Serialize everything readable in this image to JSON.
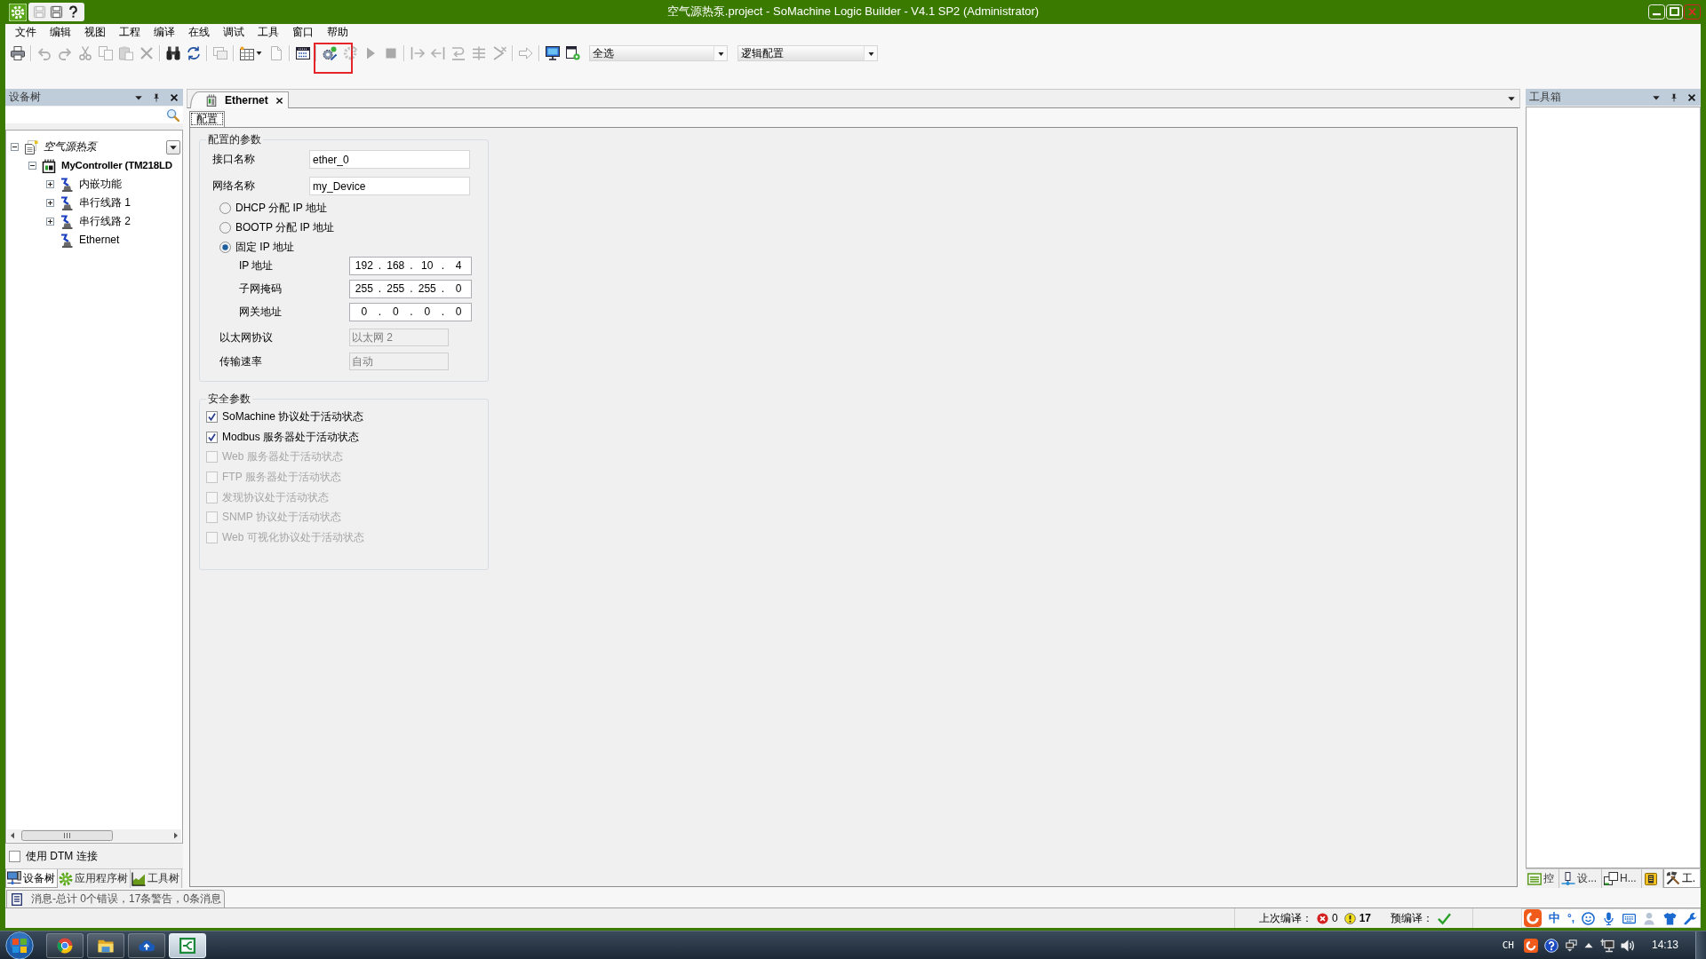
{
  "window": {
    "title": "空气源热泵.project - SoMachine Logic Builder - V4.1 SP2 (Administrator)"
  },
  "quick_access": [
    {
      "disabled": true
    },
    {
      "disabled": false
    },
    {
      "disabled": false
    }
  ],
  "menu": [
    "文件",
    "编辑",
    "视图",
    "工程",
    "编译",
    "在线",
    "调试",
    "工具",
    "窗口",
    "帮助"
  ],
  "toolbar": {
    "buttons": [
      {
        "disabled": false,
        "highlighted": false
      },
      {
        "disabled": true,
        "highlighted": false
      },
      {
        "disabled": true,
        "highlighted": false
      },
      {
        "disabled": true,
        "highlighted": false
      },
      {
        "disabled": true,
        "highlighted": false
      },
      {
        "disabled": true,
        "highlighted": false
      },
      {
        "disabled": true,
        "highlighted": false
      },
      {
        "disabled": false,
        "highlighted": false
      },
      {
        "disabled": false,
        "highlighted": false
      },
      {
        "disabled": true,
        "highlighted": false
      },
      {
        "disabled": false,
        "highlighted": false
      },
      {
        "disabled": true,
        "highlighted": false
      },
      {
        "disabled": false,
        "highlighted": false
      },
      {
        "disabled": false,
        "highlighted": true
      },
      {
        "disabled": true,
        "highlighted": false
      },
      {
        "disabled": true,
        "highlighted": false
      },
      {
        "disabled": true,
        "highlighted": false
      },
      {
        "disabled": true,
        "highlighted": false
      },
      {
        "disabled": true,
        "highlighted": false
      },
      {
        "disabled": true,
        "highlighted": false
      },
      {
        "disabled": true,
        "highlighted": false
      },
      {
        "disabled": true,
        "highlighted": false
      },
      {
        "disabled": true,
        "highlighted": false
      },
      {
        "disabled": false,
        "highlighted": false
      },
      {
        "disabled": false,
        "highlighted": false
      }
    ],
    "selects": [
      {
        "value": "全选"
      },
      {
        "value": "逻辑配置"
      }
    ]
  },
  "device_tree": {
    "title": "设备树",
    "items": [
      {
        "kind": "project",
        "label": "空气源热泵",
        "expanded": true,
        "children": [
          {
            "kind": "controller",
            "label": "MyController (TM218LD",
            "expanded": true,
            "children": [
              {
                "kind": "connector",
                "label": "内嵌功能",
                "expanded": false
              },
              {
                "kind": "connector",
                "label": "串行线路 1",
                "expanded": false
              },
              {
                "kind": "connector",
                "label": "串行线路 2",
                "expanded": false
              },
              {
                "kind": "connector",
                "label": "Ethernet"
              }
            ]
          }
        ]
      }
    ],
    "dtm": {
      "label": "使用 DTM 连接",
      "checked": false
    },
    "tabs": [
      {
        "label": "设备树",
        "selected": true
      },
      {
        "label": "应用程序树",
        "selected": false
      },
      {
        "label": "工具树",
        "selected": false
      }
    ]
  },
  "editor": {
    "tabs": [
      {
        "label": "Ethernet",
        "selected": true
      }
    ],
    "subtabs": [
      {
        "label": "配置",
        "selected": true
      }
    ],
    "config": {
      "title": "配置的参数",
      "fields": [
        {
          "label": "接口名称",
          "value": "ether_0"
        },
        {
          "label": "网络名称",
          "value": "my_Device"
        }
      ],
      "ip_modes": [
        {
          "label": "DHCP 分配 IP 地址",
          "selected": false
        },
        {
          "label": "BOOTP 分配 IP 地址",
          "selected": false
        },
        {
          "label": "固定 IP 地址",
          "selected": true
        }
      ],
      "octet_separator": ".",
      "addresses": [
        {
          "label": "IP 地址",
          "octets": [
            "192",
            "168",
            "10",
            "4"
          ]
        },
        {
          "label": "子网掩码",
          "octets": [
            "255",
            "255",
            "255",
            "0"
          ]
        },
        {
          "label": "网关地址",
          "octets": [
            "0",
            "0",
            "0",
            "0"
          ]
        }
      ],
      "settings": [
        {
          "label": "以太网协议",
          "value": "以太网 2",
          "disabled": true
        },
        {
          "label": "传输速率",
          "value": "自动",
          "disabled": true
        }
      ]
    },
    "security": {
      "title": "安全参数",
      "options": [
        {
          "label": "SoMachine 协议处于活动状态",
          "checked": true,
          "disabled": false
        },
        {
          "label": "Modbus 服务器处于活动状态",
          "checked": true,
          "disabled": false
        },
        {
          "label": "Web 服务器处于活动状态",
          "checked": false,
          "disabled": true
        },
        {
          "label": "FTP 服务器处于活动状态",
          "checked": false,
          "disabled": true
        },
        {
          "label": "发现协议处于活动状态",
          "checked": false,
          "disabled": true
        },
        {
          "label": "SNMP 协议处于活动状态",
          "checked": false,
          "disabled": true
        },
        {
          "label": "Web 可视化协议处于活动状态",
          "checked": false,
          "disabled": true
        }
      ]
    }
  },
  "toolbox": {
    "title": "工具箱",
    "tabs": [
      {
        "label": "控",
        "selected": false
      },
      {
        "label": "设...",
        "selected": false
      },
      {
        "label": "H...",
        "selected": false
      },
      {
        "selected": false
      },
      {
        "label": "工.",
        "selected": true
      }
    ]
  },
  "messages": {
    "text": "消息-总计 0个错误，17条警告，0条消息"
  },
  "status_bar": {
    "last_build_label": "上次编译：",
    "errors": "0",
    "warnings": "17",
    "precompile_label": "预编译：",
    "precompile_ok": true
  },
  "ime_bar": {
    "mode": "中",
    "punctuation": "°,"
  },
  "taskbar": {
    "apps": [
      {
        "selected": false
      },
      {
        "selected": false
      },
      {
        "selected": false
      },
      {
        "selected": true
      }
    ],
    "language": "CH",
    "clock": "14:13"
  }
}
